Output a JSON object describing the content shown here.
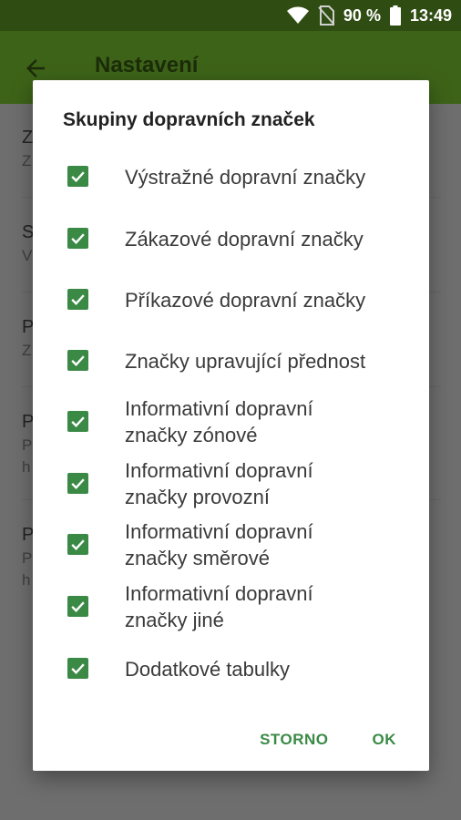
{
  "status_bar": {
    "battery": "90 %",
    "time": "13:49"
  },
  "app_bar": {
    "title": "Nastavení",
    "back_icon": "arrow-back-icon"
  },
  "background_list": [
    {
      "title": "Z",
      "subtitle": "Z"
    },
    {
      "title": "S",
      "subtitle": "V"
    },
    {
      "title": "P",
      "subtitle": "Z"
    },
    {
      "title": "P",
      "subtitle": "P",
      "subtitle2": "h"
    },
    {
      "title": "P",
      "subtitle": "P",
      "subtitle2": "h"
    }
  ],
  "dialog": {
    "title": "Skupiny dopravních značek",
    "options": [
      {
        "line1": "Výstražné dopravní značky",
        "line2": "",
        "checked": true
      },
      {
        "line1": "Zákazové dopravní značky",
        "line2": "",
        "checked": true
      },
      {
        "line1": "Příkazové dopravní značky",
        "line2": "",
        "checked": true
      },
      {
        "line1": "Značky upravující přednost",
        "line2": "",
        "checked": true
      },
      {
        "line1": "Informativní dopravní",
        "line2": "značky zónové",
        "checked": true
      },
      {
        "line1": "Informativní dopravní",
        "line2": "značky provozní",
        "checked": true
      },
      {
        "line1": "Informativní dopravní",
        "line2": "značky směrové",
        "checked": true
      },
      {
        "line1": "Informativní dopravní",
        "line2": "značky jiné",
        "checked": true
      },
      {
        "line1": "Dodatkové tabulky",
        "line2": "",
        "checked": true
      }
    ],
    "cancel_label": "STORNO",
    "ok_label": "OK"
  },
  "colors": {
    "status_bar": "#2f4c12",
    "app_bar": "#3d6318",
    "accent": "#3a8a45",
    "scrim": "#6e6e6e"
  }
}
